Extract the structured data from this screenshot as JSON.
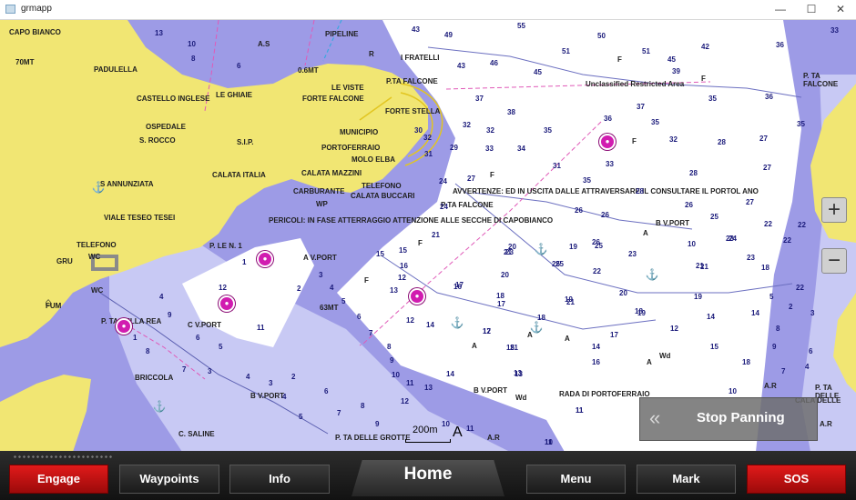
{
  "window": {
    "title": "grmapp",
    "minimize": "—",
    "maximize": "☐",
    "close": "✕"
  },
  "chart": {
    "place_labels": [
      "CAPO BIANCO",
      "70MT",
      "PADULELLA",
      "CASTELLO INGLESE",
      "LE GHIAIE",
      "OSPEDALE",
      "S. ROCCO",
      "S.I.P.",
      "S ANNUNZIATA",
      "VIALE TESEO TESEI",
      "TELEFONO",
      "GRU",
      "WC",
      "WC",
      "FUM",
      "P. TA DELLA REA",
      "C V.PORT",
      "P. LE N. 1",
      "CALATA ITALIA",
      "CALATA MAZZINI",
      "CARBURANTE",
      "WP",
      "CALATA BUCCARI",
      "TELEFONO",
      "MUNICIPIO",
      "PORTOFERRAIO",
      "MOLO ELBA",
      "FORTE STELLA",
      "FORTE FALCONE",
      "LE VISTE",
      "P.TA FALCONE",
      "0.6MT",
      "A.S",
      "PIPELINE",
      "I FRATELLI",
      "P TA FALCONE",
      "AVVERTENZE: ED IN USCITA DALLE ATTRAVERSARE IL CONSULTARE IL PORTOL ANO",
      "PERICOLI: IN FASE ATTERRAGGIO ATTENZIONE ALLE SECCHE DI CAPOBIANCO",
      "Unclassified Restricted Area",
      "P. TA FALCONE",
      "A V.PORT",
      "63MT",
      "BRICCOLA",
      "B V.PORT",
      "C. SALINE",
      "P. TA DELLE GROTTE",
      "B V.PORT",
      "Wd",
      "RADA DI PORTOFERRAIO",
      "Wd",
      "B V.PORT",
      "A.R",
      "A.R",
      "A.R",
      "CALA DELLE",
      "P. TA DELLE",
      "R",
      "F",
      "F",
      "F",
      "F",
      "F",
      "F",
      "A",
      "A",
      "A",
      "A",
      "A"
    ],
    "depths": [
      "43",
      "49",
      "55",
      "51",
      "50",
      "43",
      "46",
      "45",
      "51",
      "45",
      "42",
      "39",
      "36",
      "35",
      "36",
      "33",
      "37",
      "38",
      "37",
      "35",
      "35",
      "32",
      "32",
      "33",
      "34",
      "32",
      "31",
      "36",
      "33",
      "35",
      "35",
      "28",
      "27",
      "28",
      "27",
      "30",
      "32",
      "31",
      "28",
      "26",
      "26",
      "29",
      "24",
      "27",
      "25",
      "26",
      "27",
      "22",
      "22",
      "23",
      "22",
      "21",
      "21",
      "22",
      "20",
      "25",
      "19",
      "18",
      "17",
      "18",
      "16",
      "15",
      "14",
      "13",
      "12",
      "13",
      "12",
      "11",
      "11",
      "11",
      "10",
      "12",
      "14",
      "16",
      "15",
      "14",
      "17",
      "18",
      "19",
      "20",
      "21",
      "22",
      "23",
      "24",
      "23",
      "25",
      "25",
      "26",
      "24",
      "23",
      "21",
      "21",
      "19",
      "18",
      "17",
      "15",
      "14",
      "13",
      "12",
      "11",
      "10",
      "9",
      "8",
      "7",
      "6",
      "5",
      "4",
      "3",
      "2",
      "1",
      "13",
      "10",
      "8",
      "6",
      "4",
      "9",
      "8",
      "7",
      "6",
      "5",
      "4",
      "3",
      "2",
      "1",
      "3",
      "4",
      "5",
      "6",
      "7",
      "8",
      "9",
      "10",
      "11",
      "12",
      "15",
      "16",
      "17",
      "18",
      "19",
      "20",
      "21",
      "14",
      "13",
      "12",
      "11",
      "10",
      "8",
      "9",
      "10",
      "7",
      "5",
      "2",
      "3",
      "6",
      "4"
    ],
    "scale": "200m",
    "north": "A"
  },
  "controls": {
    "zoom_in": "+",
    "zoom_out": "−",
    "stop_panning_icon": "«",
    "stop_panning": "Stop Panning"
  },
  "bottom_bar": {
    "engage": "Engage",
    "waypoints": "Waypoints",
    "info": "Info",
    "home": "Home",
    "menu": "Menu",
    "mark": "Mark",
    "sos": "SOS"
  },
  "colors": {
    "land": "#f1e673",
    "shallow": "#9d9be6",
    "shallow_light": "#c8c9f4",
    "deep": "#ffffff",
    "marker": "#d11cb0",
    "accent_red": "#d41414"
  }
}
